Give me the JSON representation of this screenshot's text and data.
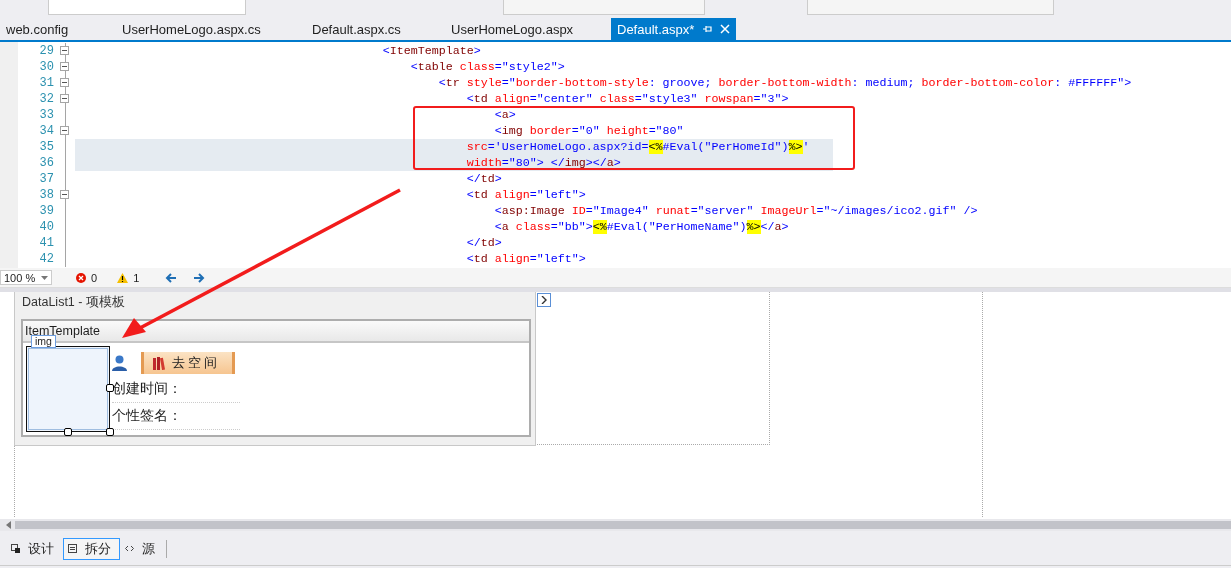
{
  "document_tabs": [
    {
      "label": "web.config",
      "selected": false
    },
    {
      "label": "UserHomeLogo.aspx.cs",
      "selected": false
    },
    {
      "label": "Default.aspx.cs",
      "selected": false
    },
    {
      "label": "UserHomeLogo.aspx",
      "selected": false
    },
    {
      "label": "Default.aspx*",
      "selected": true
    }
  ],
  "editor": {
    "lines": [
      {
        "number": "29",
        "fold": true,
        "selected": false,
        "tokens": [
          {
            "kind": "delim",
            "text": "                                            <"
          },
          {
            "kind": "tag",
            "text": "ItemTemplate"
          },
          {
            "kind": "delim",
            "text": ">"
          }
        ]
      },
      {
        "number": "30",
        "fold": true,
        "selected": false,
        "tokens": [
          {
            "kind": "delim",
            "text": "                                                <"
          },
          {
            "kind": "tag",
            "text": "table"
          },
          {
            "kind": "attr",
            "text": " class"
          },
          {
            "kind": "delim",
            "text": "=\"style2\">"
          }
        ]
      },
      {
        "number": "31",
        "fold": true,
        "selected": false,
        "tokens": [
          {
            "kind": "delim",
            "text": "                                                    <"
          },
          {
            "kind": "tag",
            "text": "tr"
          },
          {
            "kind": "attr",
            "text": " style"
          },
          {
            "kind": "delim",
            "text": "=\""
          },
          {
            "kind": "attr",
            "text": "border-bottom-style"
          },
          {
            "kind": "delim",
            "text": ": groove; "
          },
          {
            "kind": "attr",
            "text": "border-bottom-width"
          },
          {
            "kind": "delim",
            "text": ": medium; "
          },
          {
            "kind": "attr",
            "text": "border-bottom-color"
          },
          {
            "kind": "delim",
            "text": ": #FFFFFF\">"
          }
        ]
      },
      {
        "number": "32",
        "fold": true,
        "selected": false,
        "tokens": [
          {
            "kind": "delim",
            "text": "                                                        <"
          },
          {
            "kind": "tag",
            "text": "td"
          },
          {
            "kind": "attr",
            "text": " align"
          },
          {
            "kind": "delim",
            "text": "=\"center\""
          },
          {
            "kind": "attr",
            "text": " class"
          },
          {
            "kind": "delim",
            "text": "=\"style3\""
          },
          {
            "kind": "attr",
            "text": " rowspan"
          },
          {
            "kind": "delim",
            "text": "=\"3\">"
          }
        ]
      },
      {
        "number": "33",
        "fold": false,
        "selected": false,
        "tokens": [
          {
            "kind": "delim",
            "text": "                                                            <"
          },
          {
            "kind": "tag",
            "text": "a"
          },
          {
            "kind": "delim",
            "text": ">"
          }
        ]
      },
      {
        "number": "34",
        "fold": true,
        "selected": false,
        "tokens": [
          {
            "kind": "delim",
            "text": "                                                            <"
          },
          {
            "kind": "tag",
            "text": "img"
          },
          {
            "kind": "attr",
            "text": " border"
          },
          {
            "kind": "delim",
            "text": "=\"0\""
          },
          {
            "kind": "attr",
            "text": " height"
          },
          {
            "kind": "delim",
            "text": "=\"80\""
          }
        ]
      },
      {
        "number": "35",
        "fold": false,
        "selected": true,
        "tokens": [
          {
            "kind": "attr",
            "text": "                                                        src"
          },
          {
            "kind": "delim",
            "text": "='UserHomeLogo.aspx?id="
          },
          {
            "kind": "server",
            "text": "<%"
          },
          {
            "kind": "delim",
            "text": "#Eval(\"PerHomeId\")"
          },
          {
            "kind": "server",
            "text": "%>"
          },
          {
            "kind": "delim",
            "text": "'"
          }
        ]
      },
      {
        "number": "36",
        "fold": false,
        "selected": true,
        "tokens": [
          {
            "kind": "attr",
            "text": "                                                        width"
          },
          {
            "kind": "delim",
            "text": "=\"80\"> </"
          },
          {
            "kind": "tag",
            "text": "img"
          },
          {
            "kind": "delim",
            "text": "></"
          },
          {
            "kind": "tag",
            "text": "a"
          },
          {
            "kind": "delim",
            "text": ">"
          }
        ]
      },
      {
        "number": "37",
        "fold": false,
        "selected": false,
        "tokens": [
          {
            "kind": "delim",
            "text": "                                                        </"
          },
          {
            "kind": "tag",
            "text": "td"
          },
          {
            "kind": "delim",
            "text": ">"
          }
        ]
      },
      {
        "number": "38",
        "fold": true,
        "selected": false,
        "tokens": [
          {
            "kind": "delim",
            "text": "                                                        <"
          },
          {
            "kind": "tag",
            "text": "td"
          },
          {
            "kind": "attr",
            "text": " align"
          },
          {
            "kind": "delim",
            "text": "=\"left\">"
          }
        ]
      },
      {
        "number": "39",
        "fold": false,
        "selected": false,
        "tokens": [
          {
            "kind": "delim",
            "text": "                                                            <"
          },
          {
            "kind": "tag",
            "text": "asp:Image"
          },
          {
            "kind": "attr",
            "text": " ID"
          },
          {
            "kind": "delim",
            "text": "=\"Image4\""
          },
          {
            "kind": "attr",
            "text": " runat"
          },
          {
            "kind": "delim",
            "text": "=\"server\""
          },
          {
            "kind": "attr",
            "text": " ImageUrl"
          },
          {
            "kind": "delim",
            "text": "=\"~/images/ico2.gif\" />"
          }
        ]
      },
      {
        "number": "40",
        "fold": false,
        "selected": false,
        "tokens": [
          {
            "kind": "delim",
            "text": "                                                            <"
          },
          {
            "kind": "tag",
            "text": "a"
          },
          {
            "kind": "attr",
            "text": " class"
          },
          {
            "kind": "delim",
            "text": "=\"bb\">"
          },
          {
            "kind": "server",
            "text": "<%"
          },
          {
            "kind": "delim",
            "text": "#Eval(\"PerHomeName\")"
          },
          {
            "kind": "server",
            "text": "%>"
          },
          {
            "kind": "delim",
            "text": "</"
          },
          {
            "kind": "tag",
            "text": "a"
          },
          {
            "kind": "delim",
            "text": ">"
          }
        ]
      },
      {
        "number": "41",
        "fold": false,
        "selected": false,
        "tokens": [
          {
            "kind": "delim",
            "text": "                                                        </"
          },
          {
            "kind": "tag",
            "text": "td"
          },
          {
            "kind": "delim",
            "text": ">"
          }
        ]
      },
      {
        "number": "42",
        "fold": false,
        "selected": false,
        "tokens": [
          {
            "kind": "delim",
            "text": "                                                        <"
          },
          {
            "kind": "tag",
            "text": "td"
          },
          {
            "kind": "attr",
            "text": " align"
          },
          {
            "kind": "delim",
            "text": "=\"left\">"
          }
        ]
      }
    ]
  },
  "status": {
    "zoom": "100 %",
    "errors": "0",
    "warnings": "1"
  },
  "design": {
    "panel_title": "DataList1 - 项模板",
    "template_title": "ItemTemplate",
    "element_tag": "img",
    "link_button": "去空间",
    "rows": [
      "创建时间：",
      "个性签名："
    ]
  },
  "view_tabs": [
    {
      "label": "设计",
      "selected": false
    },
    {
      "label": "拆分",
      "selected": true
    },
    {
      "label": "源",
      "selected": false
    }
  ]
}
